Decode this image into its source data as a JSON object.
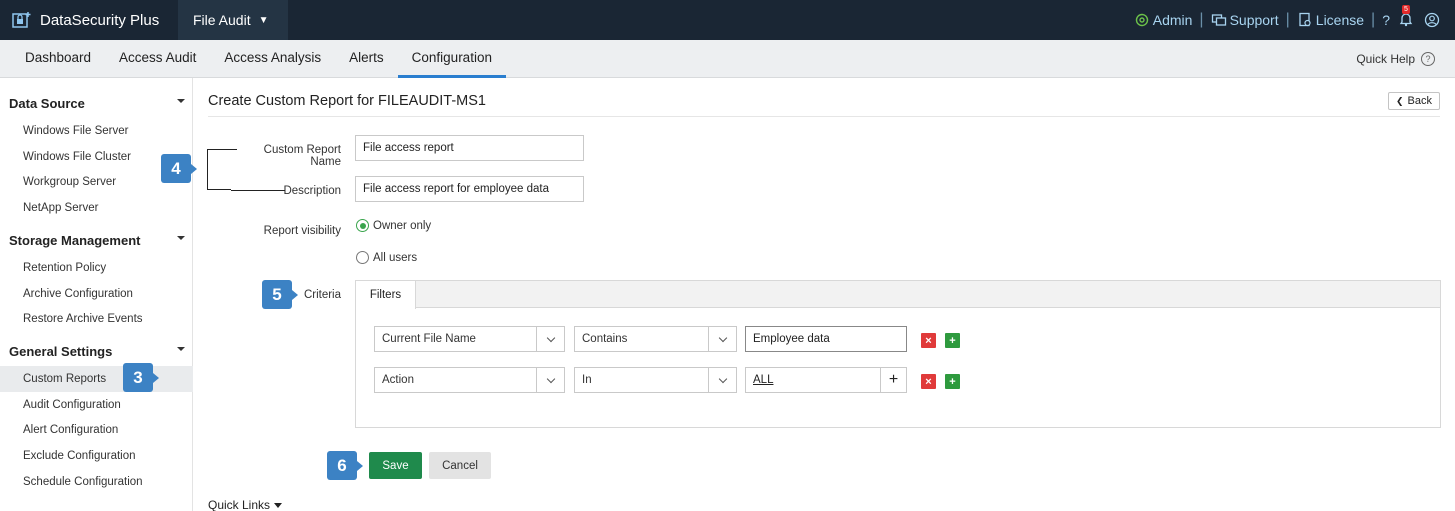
{
  "app": {
    "brand_name": "DataSecurity Plus",
    "module": "File Audit"
  },
  "topbar": {
    "admin": "Admin",
    "support": "Support",
    "license": "License",
    "help_glyph": "?",
    "notification_count": "5",
    "separator": "|"
  },
  "nav": {
    "tabs": [
      "Dashboard",
      "Access Audit",
      "Access Analysis",
      "Alerts",
      "Configuration"
    ],
    "active_tab": "Configuration",
    "quick_help": "Quick Help",
    "quick_help_icon": "?"
  },
  "sidebar": {
    "sections": [
      {
        "title": "Data Source",
        "items": [
          "Windows File Server",
          "Windows File Cluster",
          "Workgroup Server",
          "NetApp Server"
        ]
      },
      {
        "title": "Storage Management",
        "items": [
          "Retention Policy",
          "Archive Configuration",
          "Restore Archive Events"
        ]
      },
      {
        "title": "General Settings",
        "items": [
          "Custom Reports",
          "Audit Configuration",
          "Alert Configuration",
          "Exclude Configuration",
          "Schedule Configuration"
        ]
      }
    ],
    "active_item": "Custom Reports"
  },
  "page": {
    "title": "Create Custom Report for FILEAUDIT-MS1",
    "back_label": "Back"
  },
  "form": {
    "report_name_label": "Custom Report Name",
    "report_name_value": "File access report",
    "description_label": "Description",
    "description_value": "File access report for employee data",
    "visibility_label": "Report visibility",
    "visibility_options": [
      "Owner only",
      "All users"
    ],
    "visibility_selected": "Owner only",
    "criteria_label": "Criteria",
    "criteria_tab": "Filters",
    "filters": [
      {
        "field": "Current File Name",
        "operator": "Contains",
        "value": "Employee data"
      },
      {
        "field": "Action",
        "operator": "In",
        "value": "ALL"
      }
    ],
    "remove_glyph": "×",
    "add_glyph": "+",
    "save_label": "Save",
    "cancel_label": "Cancel"
  },
  "quick_links": "Quick Links",
  "steps": [
    "3",
    "4",
    "5",
    "6"
  ],
  "colors": {
    "topbar_bg": "#1a2634",
    "active_tab_underline": "#2a7ecf",
    "save_button": "#1f8a4c",
    "step_callout": "#3c82c4",
    "delete_button": "#e03a3a",
    "add_button": "#2e9a3e"
  }
}
